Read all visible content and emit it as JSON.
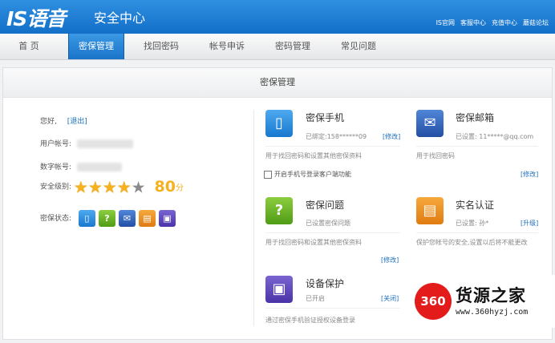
{
  "header": {
    "logo": "IS语音",
    "title": "安全中心",
    "links": [
      "IS官网",
      "客服中心",
      "充值中心",
      "蘑菇论坛"
    ]
  },
  "nav": {
    "tabs": [
      "首 页",
      "密保管理",
      "找回密码",
      "帐号申诉",
      "密码管理",
      "常见问题"
    ],
    "active": "密保管理"
  },
  "panel": {
    "title": "密保管理",
    "greeting": "您好,",
    "logout": "[退出]",
    "user_account_label": "用户帐号:",
    "number_account_label": "数字帐号:",
    "security_level_label": "安全级别:",
    "stars_filled": 4,
    "stars_total": 5,
    "score": "80",
    "score_unit": "分",
    "security_status_label": "密保状态:"
  },
  "features": {
    "phone": {
      "title": "密保手机",
      "status": "已绑定:158******09",
      "action": "[修改]",
      "desc": "用于找回密码和设置其他密保资料",
      "checkbox_label": "开启手机号登录客户端功能"
    },
    "email": {
      "title": "密保邮箱",
      "status": "已设置: 11*****@qq.com",
      "desc": "用于找回密码",
      "action": "[修改]"
    },
    "question": {
      "title": "密保问题",
      "status": "已设置密保问题",
      "desc": "用于找回密码和设置其他密保资料",
      "action": "[修改]"
    },
    "realname": {
      "title": "实名认证",
      "status": "已设置: 孙*",
      "action": "[升级]",
      "desc": "保护您帐号的安全,设置以后将不能更改"
    },
    "device": {
      "title": "设备保护",
      "status": "已开启",
      "action": "[关闭]",
      "desc": "通过密保手机验证授权设备登录"
    }
  },
  "watermark": {
    "badge": "360",
    "title": "货源之家",
    "url": "www.360hyzj.com"
  },
  "icons": {
    "phone": "mobile-phone-icon",
    "question": "question-icon",
    "email": "envelope-icon",
    "realname": "id-card-icon",
    "device": "device-lock-icon"
  },
  "colors": {
    "header": "#1a78d0",
    "accent_star": "#f5b21e",
    "link": "#1a6fbd"
  }
}
